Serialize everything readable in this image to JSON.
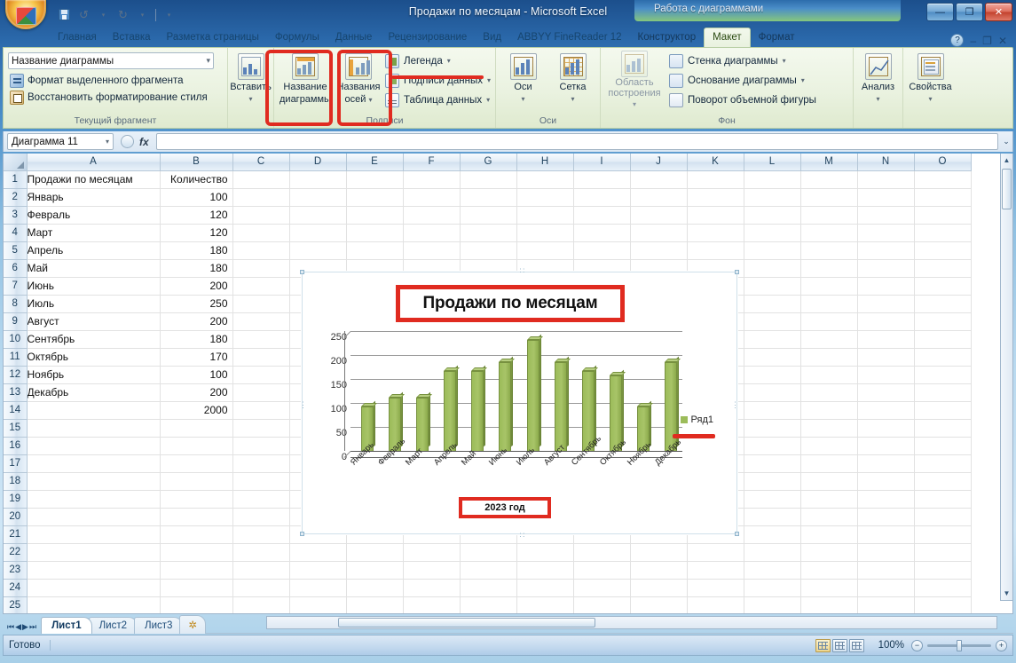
{
  "window": {
    "title": "Продажи по месяцам - Microsoft Excel",
    "context_banner": "Работа с диаграммами",
    "minimize": "—",
    "maximize": "❐",
    "close": "✕"
  },
  "quick_access": {
    "save_tip": "Сохранить",
    "undo": "↺",
    "redo": "↻",
    "dropdown": "▾",
    "customize": "▾"
  },
  "ribbon": {
    "tabs": [
      {
        "label": "Главная",
        "active": false
      },
      {
        "label": "Вставка",
        "active": false
      },
      {
        "label": "Разметка страницы",
        "active": false
      },
      {
        "label": "Формулы",
        "active": false
      },
      {
        "label": "Данные",
        "active": false
      },
      {
        "label": "Рецензирование",
        "active": false
      },
      {
        "label": "Вид",
        "active": false
      },
      {
        "label": "ABBYY FineReader 12",
        "active": false
      },
      {
        "label": "Конструктор",
        "active": false
      },
      {
        "label": "Макет",
        "active": true
      },
      {
        "label": "Формат",
        "active": false
      }
    ],
    "groups": {
      "current_fragment": {
        "label": "Текущий фрагмент",
        "combo_value": "Название диаграммы",
        "combo_caret": "▾",
        "format_selection": "Формат выделенного фрагмента",
        "restore_style": "Восстановить форматирование стиля"
      },
      "insert": {
        "label": "Вставить",
        "caret": "▾"
      },
      "labels": {
        "label": "Подписи",
        "chart_title": "Название\nдиаграммы",
        "chart_title_l1": "Название",
        "chart_title_l2": "диаграммы",
        "axis_titles_l1": "Названия",
        "axis_titles_l2": "осей",
        "axis_titles_caret": "▾",
        "legend": "Легенда",
        "data_labels": "Подписи данных",
        "data_table": "Таблица данных",
        "caret": "▾"
      },
      "axes": {
        "label": "Оси",
        "axes": "Оси",
        "gridlines": "Сетка",
        "caret": "▾"
      },
      "background": {
        "label": "Фон",
        "plot_area_l1": "Область",
        "plot_area_l2": "построения",
        "chart_wall": "Стенка диаграммы",
        "chart_floor": "Основание диаграммы",
        "rotation_3d": "Поворот объемной фигуры",
        "caret": "▾"
      },
      "analysis": {
        "label": "Анализ",
        "caret": "▾"
      },
      "properties": {
        "label": "Свойства",
        "caret": "▾"
      }
    },
    "help_icon": "?"
  },
  "formula_bar": {
    "name_box_value": "Диаграмма 11",
    "name_box_caret": "▾",
    "fx_label": "fx",
    "formula_value": "",
    "expand_caret": "⌄"
  },
  "grid": {
    "columns": [
      "A",
      "B",
      "C",
      "D",
      "E",
      "F",
      "G",
      "H",
      "I",
      "J",
      "K",
      "L",
      "M",
      "N",
      "O"
    ],
    "rows": [
      {
        "n": "1",
        "a": "Продажи по месяцам",
        "b": "Количество"
      },
      {
        "n": "2",
        "a": "Январь",
        "b": "100"
      },
      {
        "n": "3",
        "a": "Февраль",
        "b": "120"
      },
      {
        "n": "4",
        "a": "Март",
        "b": "120"
      },
      {
        "n": "5",
        "a": "Апрель",
        "b": "180"
      },
      {
        "n": "6",
        "a": "Май",
        "b": "180"
      },
      {
        "n": "7",
        "a": "Июнь",
        "b": "200"
      },
      {
        "n": "8",
        "a": "Июль",
        "b": "250"
      },
      {
        "n": "9",
        "a": "Август",
        "b": "200"
      },
      {
        "n": "10",
        "a": "Сентябрь",
        "b": "180"
      },
      {
        "n": "11",
        "a": "Октябрь",
        "b": "170"
      },
      {
        "n": "12",
        "a": "Ноябрь",
        "b": "100"
      },
      {
        "n": "13",
        "a": "Декабрь",
        "b": "200"
      },
      {
        "n": "14",
        "a": "",
        "b": "2000"
      },
      {
        "n": "15",
        "a": "",
        "b": ""
      },
      {
        "n": "16",
        "a": "",
        "b": ""
      },
      {
        "n": "17",
        "a": "",
        "b": ""
      },
      {
        "n": "18",
        "a": "",
        "b": ""
      },
      {
        "n": "19",
        "a": "",
        "b": ""
      },
      {
        "n": "20",
        "a": "",
        "b": ""
      },
      {
        "n": "21",
        "a": "",
        "b": ""
      },
      {
        "n": "22",
        "a": "",
        "b": ""
      },
      {
        "n": "23",
        "a": "",
        "b": ""
      },
      {
        "n": "24",
        "a": "",
        "b": ""
      },
      {
        "n": "25",
        "a": "",
        "b": ""
      }
    ]
  },
  "chart_data": {
    "type": "bar",
    "title": "Продажи по месяцам",
    "xlabel": "2023 год",
    "ylabel": "",
    "categories": [
      "Январь",
      "Февраль",
      "Март",
      "Апрель",
      "Май",
      "Июнь",
      "Июль",
      "Август",
      "Сентябрь",
      "Октябрь",
      "Ноябрь",
      "Декабрь"
    ],
    "values": [
      100,
      120,
      120,
      180,
      180,
      200,
      250,
      200,
      180,
      170,
      100,
      200
    ],
    "series": [
      {
        "name": "Ряд1",
        "values": [
          100,
          120,
          120,
          180,
          180,
          200,
          250,
          200,
          180,
          170,
          100,
          200
        ]
      }
    ],
    "yticks": [
      0,
      50,
      100,
      150,
      200,
      250
    ],
    "ylim": [
      0,
      270
    ],
    "grid": true,
    "legend_position": "right",
    "legend_entries": [
      "Ряд1"
    ],
    "bar_color": "#9cbc5a",
    "style": "3d-column"
  },
  "sheet_tabs": {
    "nav_first": "⏮",
    "nav_prev": "◀",
    "nav_next": "▶",
    "nav_last": "⏭",
    "tabs": [
      {
        "label": "Лист1",
        "active": true
      },
      {
        "label": "Лист2",
        "active": false
      },
      {
        "label": "Лист3",
        "active": false
      }
    ],
    "new_sheet": "✲"
  },
  "status_bar": {
    "ready": "Готово",
    "zoom": "100%",
    "zoom_out": "−",
    "zoom_in": "+",
    "view_normal": "normal-view",
    "view_layout": "page-layout-view",
    "view_pagebreak": "page-break-view"
  },
  "colors": {
    "accent_red": "#e02b20",
    "bar_green": "#9cbc5a",
    "ribbon_bg": "#eaf2e0"
  }
}
